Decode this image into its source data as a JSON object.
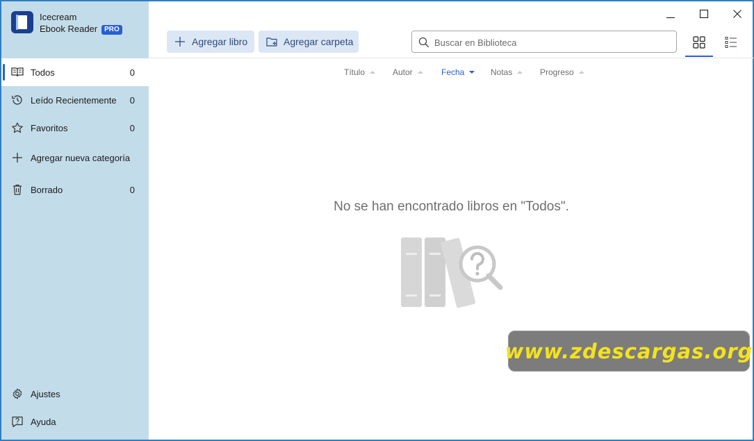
{
  "app": {
    "name_line1": "Icecream",
    "name_line2": "Ebook Reader",
    "badge": "PRO",
    "accent_color": "#2a5fd0",
    "sidebar_color": "#c3dce9"
  },
  "sidebar": {
    "items": [
      {
        "label": "Todos",
        "count": "0",
        "icon": "book-open-icon",
        "active": true
      },
      {
        "label": "Leído Recientemente",
        "count": "0",
        "icon": "history-icon"
      },
      {
        "label": "Favoritos",
        "count": "0",
        "icon": "star-icon"
      },
      {
        "label": "Agregar nueva categoría",
        "icon": "plus-icon"
      },
      {
        "label": "Borrado",
        "count": "0",
        "icon": "trash-icon"
      }
    ],
    "bottom": [
      {
        "label": "Ajustes",
        "icon": "gear-icon"
      },
      {
        "label": "Ayuda",
        "icon": "help-icon"
      }
    ]
  },
  "toolbar": {
    "add_book": "Agregar libro",
    "add_folder": "Agregar carpeta",
    "search_placeholder": "Buscar en Biblioteca"
  },
  "view": {
    "options": [
      "grid-view-icon",
      "list-view-icon"
    ],
    "selected": "grid-view-icon"
  },
  "sort": {
    "columns": [
      "Título",
      "Autor",
      "Fecha",
      "Notas",
      "Progreso"
    ],
    "active": "Fecha",
    "direction": "descending"
  },
  "empty_state": {
    "message": "No se han encontrado libros en \"Todos\"."
  },
  "watermark": {
    "text": "www.zdescargas.org",
    "text_color": "#f4e21e"
  }
}
